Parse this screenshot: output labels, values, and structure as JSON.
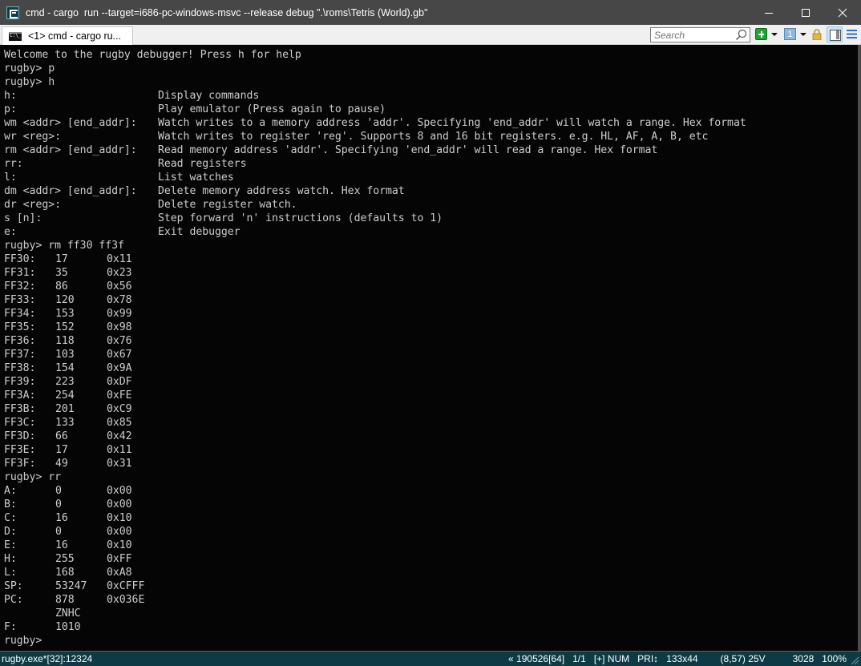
{
  "window": {
    "title": "cmd - cargo  run --target=i686-pc-windows-msvc --release debug \".\\roms\\Tetris (World).gb\"",
    "controls": {
      "minimize": "minimize-icon",
      "maximize": "maximize-icon",
      "close": "close-icon"
    }
  },
  "tabbar": {
    "tabs": [
      {
        "label": "<1> cmd - cargo  ru...",
        "icon": "console-icon",
        "active": true
      }
    ],
    "search": {
      "placeholder": "Search",
      "value": ""
    },
    "toolbar_icons": [
      "new-console-icon",
      "dropdown-icon",
      "console-number-icon",
      "dropdown-icon",
      "lock-icon",
      "split-view-icon",
      "hamburger-menu-icon"
    ],
    "console_number": "1"
  },
  "console": {
    "welcome": "Welcome to the rugby debugger! Press h for help",
    "prompt": "rugby>",
    "commands": {
      "first": "rugby> p",
      "second": "rugby> h",
      "third": "rugby> rm ff30 ff3f",
      "fourth": "rugby> rr",
      "current": "rugby>"
    },
    "help": [
      {
        "cmd": "h:",
        "desc": "Display commands"
      },
      {
        "cmd": "p:",
        "desc": "Play emulator (Press again to pause)"
      },
      {
        "cmd": "wm <addr> [end_addr]:",
        "desc": "Watch writes to a memory address 'addr'. Specifying 'end_addr' will watch a range. Hex format"
      },
      {
        "cmd": "wr <reg>:",
        "desc": "Watch writes to register 'reg'. Supports 8 and 16 bit registers. e.g. HL, AF, A, B, etc"
      },
      {
        "cmd": "rm <addr> [end_addr]:",
        "desc": "Read memory address 'addr'. Specifying 'end_addr' will read a range. Hex format"
      },
      {
        "cmd": "rr:",
        "desc": "Read registers"
      },
      {
        "cmd": "l:",
        "desc": "List watches"
      },
      {
        "cmd": "dm <addr> [end_addr]:",
        "desc": "Delete memory address watch. Hex format"
      },
      {
        "cmd": "dr <reg>:",
        "desc": "Delete register watch."
      },
      {
        "cmd": "s [n]:",
        "desc": "Step forward 'n' instructions (defaults to 1)"
      },
      {
        "cmd": "e:",
        "desc": "Exit debugger"
      }
    ],
    "memory": [
      {
        "addr": "FF30:",
        "dec": "17",
        "hex": "0x11"
      },
      {
        "addr": "FF31:",
        "dec": "35",
        "hex": "0x23"
      },
      {
        "addr": "FF32:",
        "dec": "86",
        "hex": "0x56"
      },
      {
        "addr": "FF33:",
        "dec": "120",
        "hex": "0x78"
      },
      {
        "addr": "FF34:",
        "dec": "153",
        "hex": "0x99"
      },
      {
        "addr": "FF35:",
        "dec": "152",
        "hex": "0x98"
      },
      {
        "addr": "FF36:",
        "dec": "118",
        "hex": "0x76"
      },
      {
        "addr": "FF37:",
        "dec": "103",
        "hex": "0x67"
      },
      {
        "addr": "FF38:",
        "dec": "154",
        "hex": "0x9A"
      },
      {
        "addr": "FF39:",
        "dec": "223",
        "hex": "0xDF"
      },
      {
        "addr": "FF3A:",
        "dec": "254",
        "hex": "0xFE"
      },
      {
        "addr": "FF3B:",
        "dec": "201",
        "hex": "0xC9"
      },
      {
        "addr": "FF3C:",
        "dec": "133",
        "hex": "0x85"
      },
      {
        "addr": "FF3D:",
        "dec": "66",
        "hex": "0x42"
      },
      {
        "addr": "FF3E:",
        "dec": "17",
        "hex": "0x11"
      },
      {
        "addr": "FF3F:",
        "dec": "49",
        "hex": "0x31"
      }
    ],
    "registers": [
      {
        "name": "A:",
        "dec": "0",
        "hex": "0x00"
      },
      {
        "name": "B:",
        "dec": "0",
        "hex": "0x00"
      },
      {
        "name": "C:",
        "dec": "16",
        "hex": "0x10"
      },
      {
        "name": "D:",
        "dec": "0",
        "hex": "0x00"
      },
      {
        "name": "E:",
        "dec": "16",
        "hex": "0x10"
      },
      {
        "name": "H:",
        "dec": "255",
        "hex": "0xFF"
      },
      {
        "name": "L:",
        "dec": "168",
        "hex": "0xA8"
      },
      {
        "name": "SP:",
        "dec": "53247",
        "hex": "0xCFFF"
      },
      {
        "name": "PC:",
        "dec": "878",
        "hex": "0x036E"
      }
    ],
    "flags": {
      "header": "ZNHC",
      "name": "F:",
      "value": "1010"
    }
  },
  "statusbar": {
    "process": "rugby.exe*[32]:12324",
    "items": [
      "« 190526[64]",
      "1/1",
      "[+] NUM",
      "PRI↕",
      "133x44",
      "(8,57) 25V",
      "3028",
      "100%"
    ]
  },
  "colors": {
    "titlebar": "#474747",
    "console_bg": "#050505",
    "console_text": "#cccccc",
    "statusbar_bg": "#0e3a46"
  }
}
